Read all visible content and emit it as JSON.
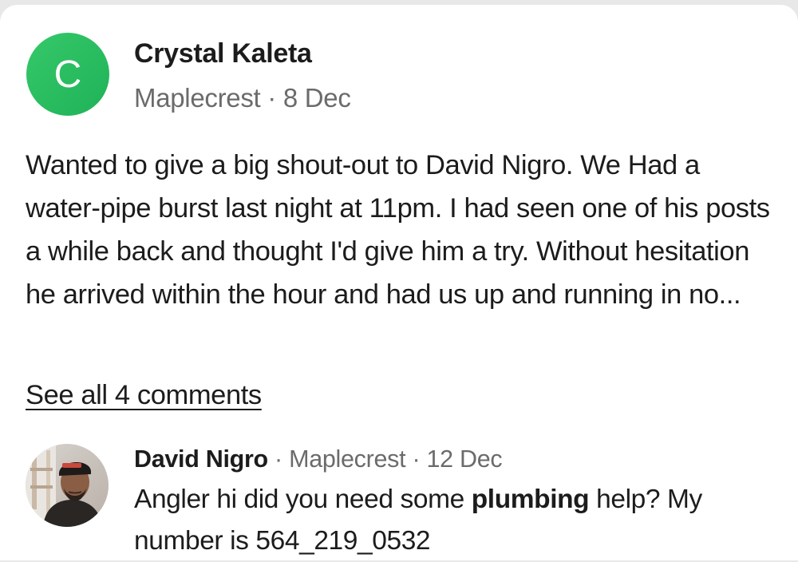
{
  "post": {
    "avatar_letter": "C",
    "author": "Crystal Kaleta",
    "location": "Maplecrest",
    "separator": " · ",
    "date": "8 Dec",
    "body": "Wanted to give a big shout-out to David Nigro. We Had a water-pipe burst last night at 11pm. I had seen one of his posts a while back and thought I'd give him a try. Without hesitation he arrived within the hour and had us up and running in no..."
  },
  "comments": {
    "see_all_label": "See all 4 comments"
  },
  "reply": {
    "author": "David Nigro",
    "separator": " · ",
    "location": "Maplecrest",
    "date": "12 Dec",
    "body_before": "Angler hi did you need some ",
    "body_bold": "plumbing",
    "body_after": " help? My number is 564_219_0532"
  },
  "colors": {
    "avatar_green": "#22b85c",
    "text_primary": "#1c1c1c",
    "text_secondary": "#6b6b6b"
  }
}
